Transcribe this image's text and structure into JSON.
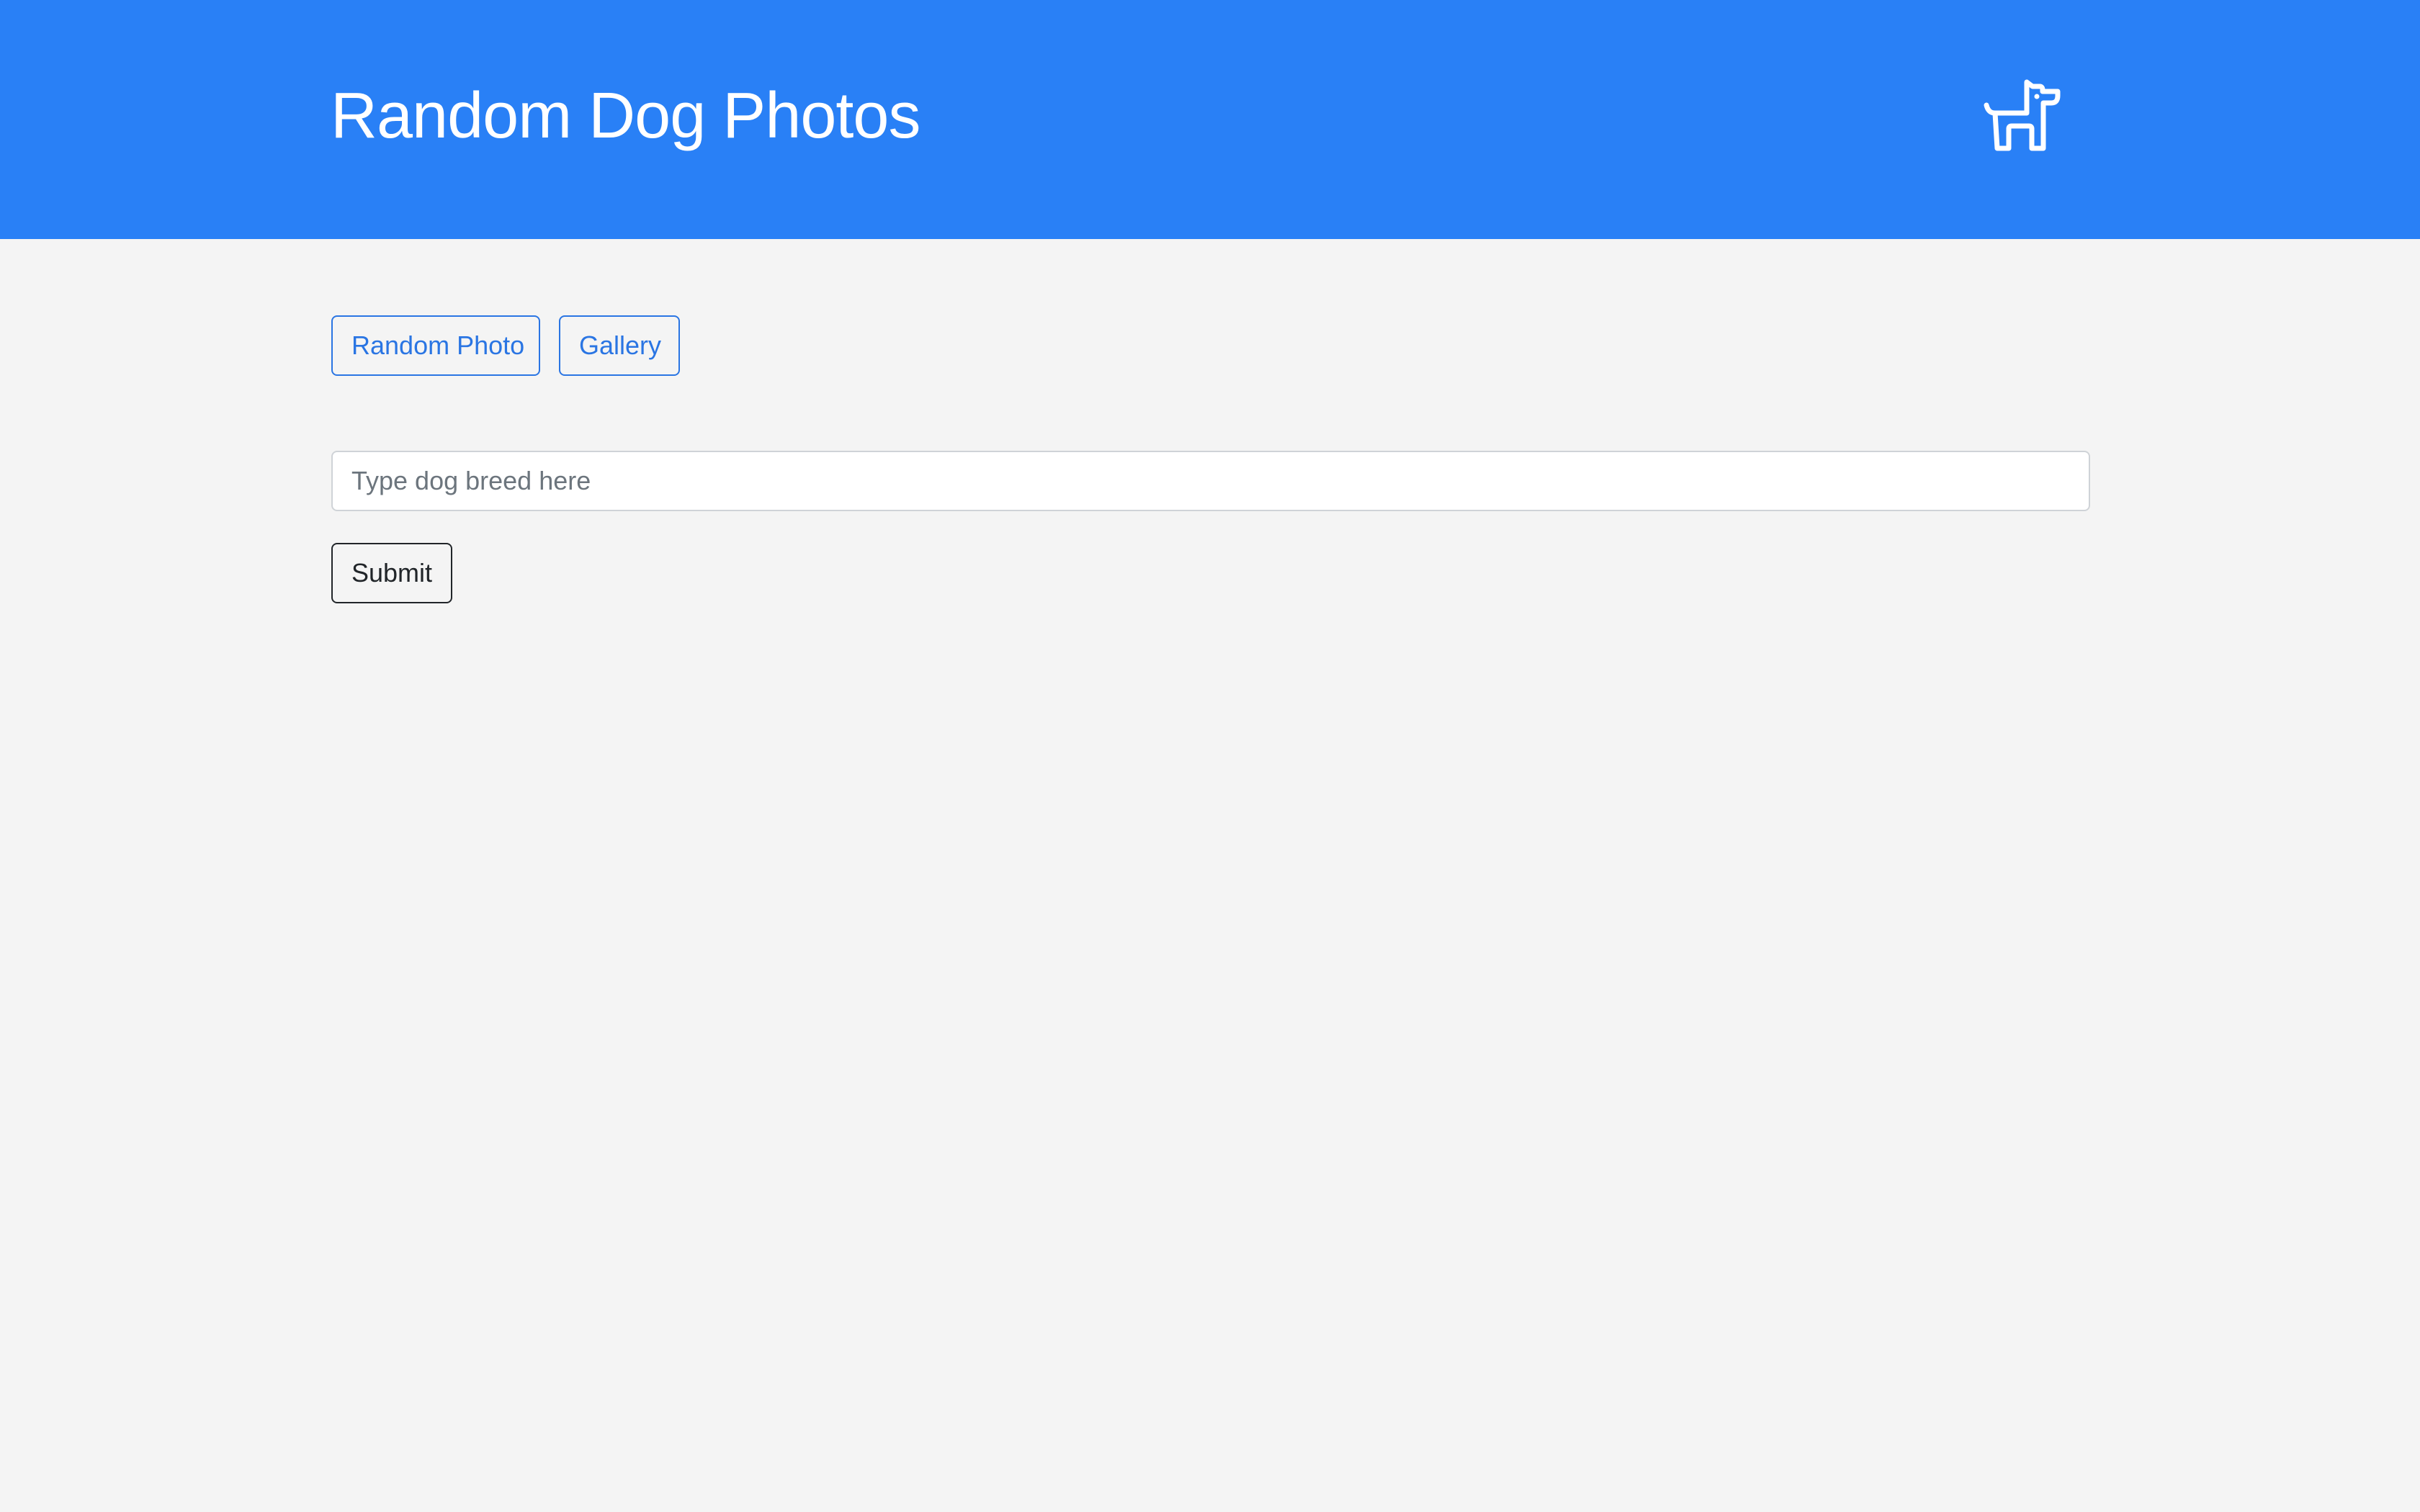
{
  "header": {
    "title": "Random Dog Photos",
    "icon": "dog-icon",
    "background_color": "#2980f6"
  },
  "nav": {
    "random_photo_label": "Random Photo",
    "gallery_label": "Gallery"
  },
  "search": {
    "value": "",
    "placeholder": "Type dog breed here"
  },
  "form": {
    "submit_label": "Submit"
  },
  "colors": {
    "accent": "#2a75e3",
    "page_background": "#f4f4f4"
  }
}
